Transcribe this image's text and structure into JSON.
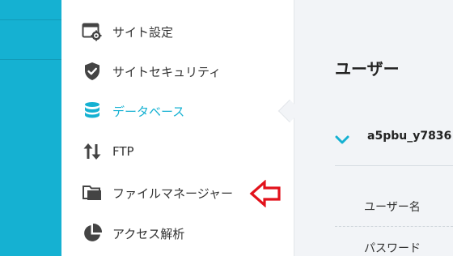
{
  "sidebar": {
    "items": [
      {
        "label": "サイト設定",
        "icon": "site-settings-icon"
      },
      {
        "label": "サイトセキュリティ",
        "icon": "shield-icon"
      },
      {
        "label": "データベース",
        "icon": "database-icon",
        "active": true
      },
      {
        "label": "FTP",
        "icon": "transfer-arrows-icon"
      },
      {
        "label": "ファイルマネージャー",
        "icon": "folder-icon"
      },
      {
        "label": "アクセス解析",
        "icon": "pie-chart-icon"
      }
    ]
  },
  "main": {
    "title": "ユーザー",
    "database": {
      "name": "a5pbu_y7836"
    },
    "fields": [
      {
        "label": "ユーザー名"
      },
      {
        "label": "パスワード"
      }
    ]
  },
  "colors": {
    "accent": "#15b1d2",
    "annotation": "#e2121b",
    "panel_bg": "#f2f4f7"
  }
}
